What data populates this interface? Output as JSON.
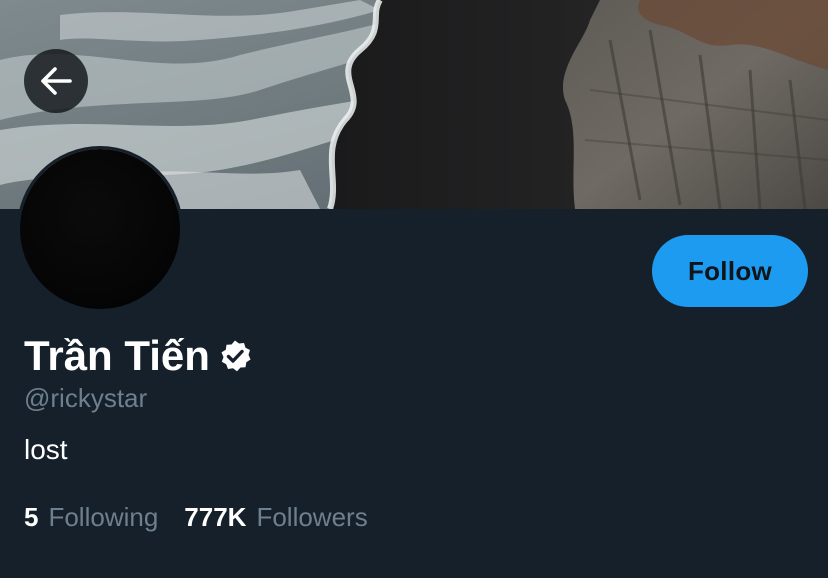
{
  "header": {
    "back_icon": "arrow-left-icon"
  },
  "profile": {
    "display_name": "Trần Tiến",
    "verified_icon": "verified-badge-icon",
    "handle": "@rickystar",
    "bio": "lost",
    "follow_label": "Follow"
  },
  "stats": {
    "following_count": "5",
    "following_label": "Following",
    "followers_count": "777K",
    "followers_label": "Followers"
  },
  "colors": {
    "background": "#15202b",
    "accent": "#1d9bf0",
    "muted_text": "#6e7f8e",
    "primary_text": "#ffffff"
  }
}
